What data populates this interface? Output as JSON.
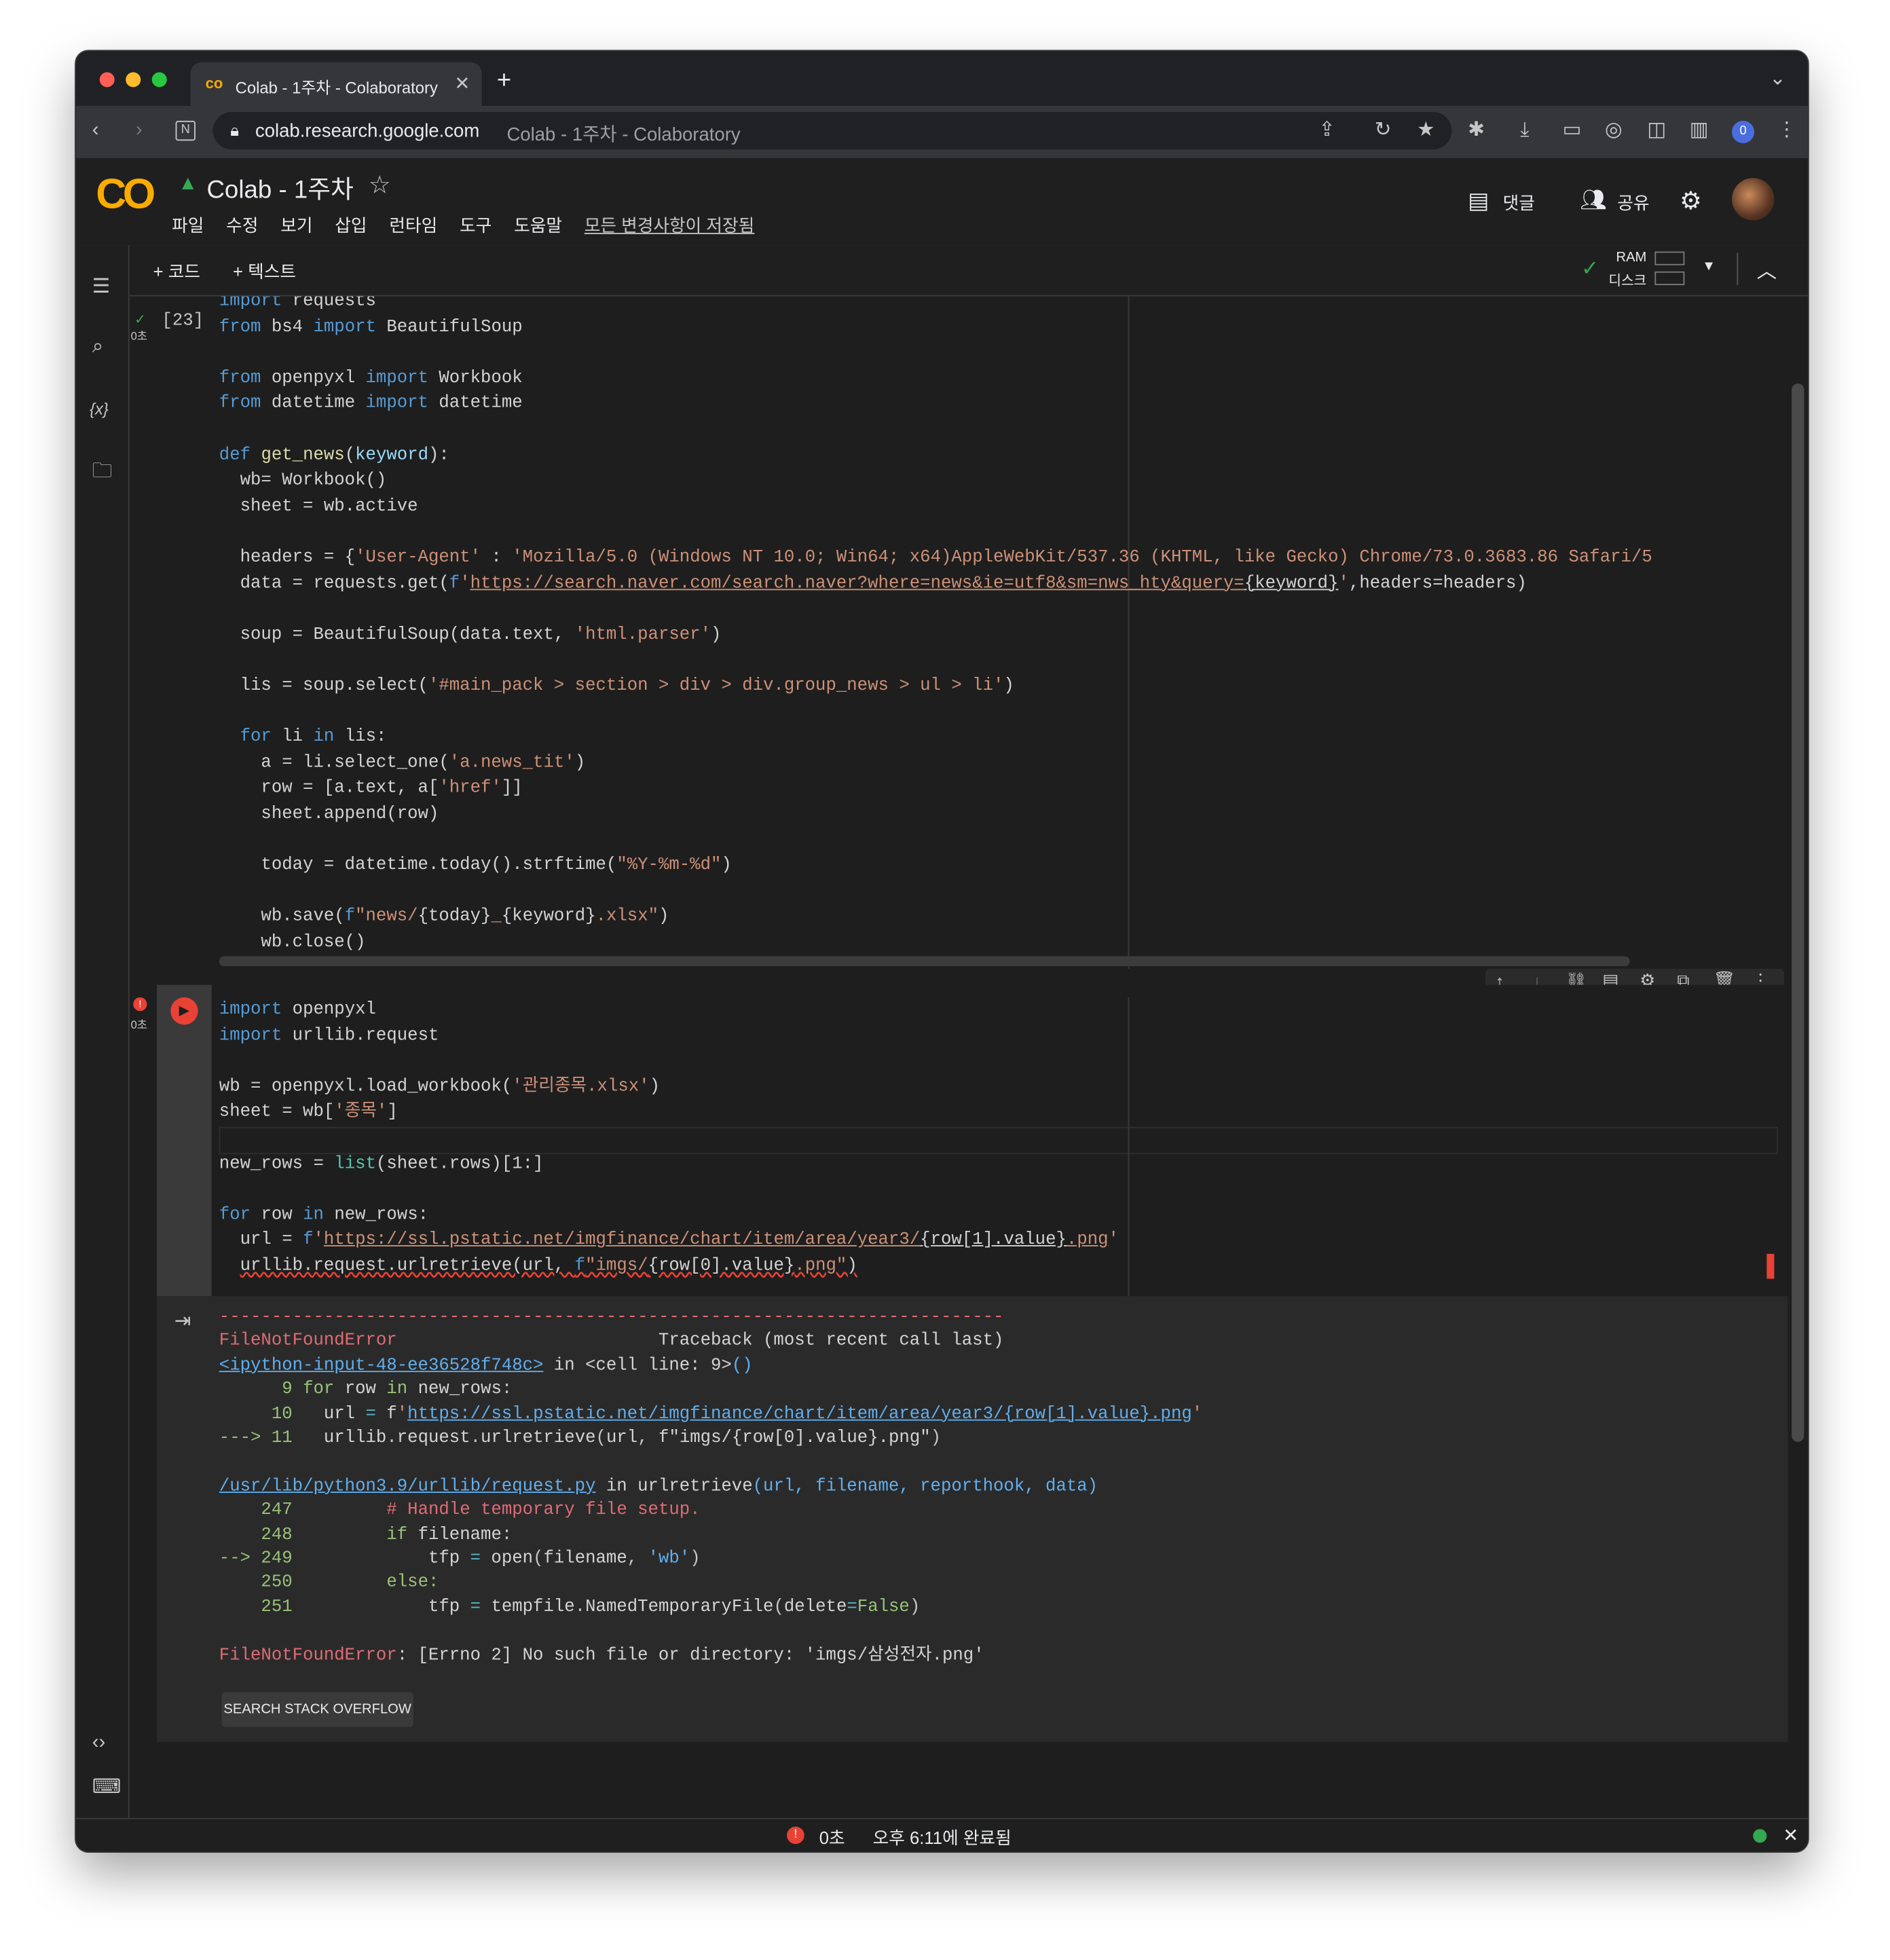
{
  "browser": {
    "tab_title": "Colab - 1주차 - Colaboratory",
    "url_host": "colab.research.google.com",
    "url_title": "Colab - 1주차 - Colaboratory",
    "profile_badge": "0"
  },
  "colab": {
    "logo": "CO",
    "doc_title": "Colab - 1주차",
    "menu": [
      "파일",
      "수정",
      "보기",
      "삽입",
      "런타임",
      "도구",
      "도움말"
    ],
    "save_status": "모든 변경사항이 저장됨",
    "comment_label": "댓글",
    "share_label": "공유"
  },
  "toolbar": {
    "add_code": "+ 코드",
    "add_text": "+ 텍스트",
    "ram_label": "RAM",
    "disk_label": "디스크"
  },
  "cell1": {
    "exec_count": "[23]",
    "exec_time": "0초"
  },
  "cell2": {
    "exec_time": "0초"
  },
  "output": {
    "search_button": "SEARCH STACK OVERFLOW"
  },
  "status_bar": {
    "time": "0초",
    "message": "오후 6:11에 완료됨"
  },
  "colors": {
    "colab_orange": "#f9ab00",
    "error_red": "#e94235",
    "connected_green": "#34a853"
  }
}
